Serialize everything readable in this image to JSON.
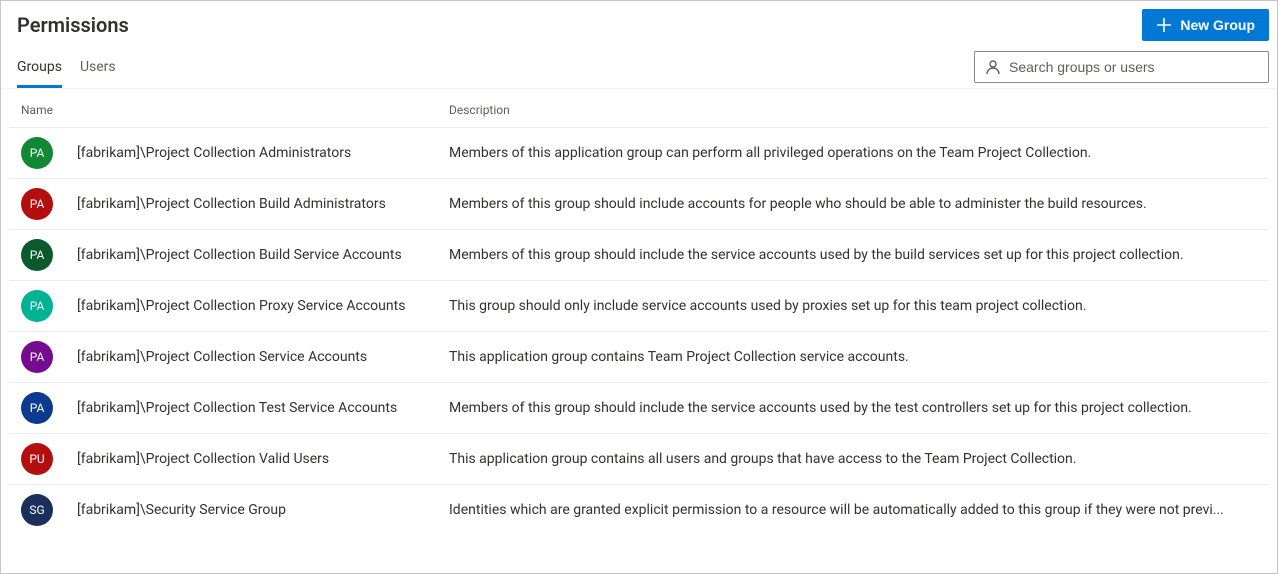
{
  "header": {
    "title": "Permissions",
    "new_group_label": "New Group"
  },
  "tabs": [
    {
      "label": "Groups",
      "active": true
    },
    {
      "label": "Users",
      "active": false
    }
  ],
  "search": {
    "placeholder": "Search groups or users"
  },
  "table": {
    "columns": {
      "name": "Name",
      "description": "Description"
    },
    "rows": [
      {
        "initials": "PA",
        "color": "#118833",
        "name": "[fabrikam]\\Project Collection Administrators",
        "description": "Members of this application group can perform all privileged operations on the Team Project Collection."
      },
      {
        "initials": "PA",
        "color": "#b50e0e",
        "name": "[fabrikam]\\Project Collection Build Administrators",
        "description": "Members of this group should include accounts for people who should be able to administer the build resources."
      },
      {
        "initials": "PA",
        "color": "#0b5a2b",
        "name": "[fabrikam]\\Project Collection Build Service Accounts",
        "description": "Members of this group should include the service accounts used by the build services set up for this project collection."
      },
      {
        "initials": "PA",
        "color": "#00b294",
        "name": "[fabrikam]\\Project Collection Proxy Service Accounts",
        "description": "This group should only include service accounts used by proxies set up for this team project collection."
      },
      {
        "initials": "PA",
        "color": "#750b8f",
        "name": "[fabrikam]\\Project Collection Service Accounts",
        "description": "This application group contains Team Project Collection service accounts."
      },
      {
        "initials": "PA",
        "color": "#0b3a8f",
        "name": "[fabrikam]\\Project Collection Test Service Accounts",
        "description": "Members of this group should include the service accounts used by the test controllers set up for this project collection."
      },
      {
        "initials": "PU",
        "color": "#b50e0e",
        "name": "[fabrikam]\\Project Collection Valid Users",
        "description": "This application group contains all users and groups that have access to the Team Project Collection."
      },
      {
        "initials": "SG",
        "color": "#1b2f5c",
        "name": "[fabrikam]\\Security Service Group",
        "description": "Identities which are granted explicit permission to a resource will be automatically added to this group if they were not previ..."
      }
    ]
  }
}
